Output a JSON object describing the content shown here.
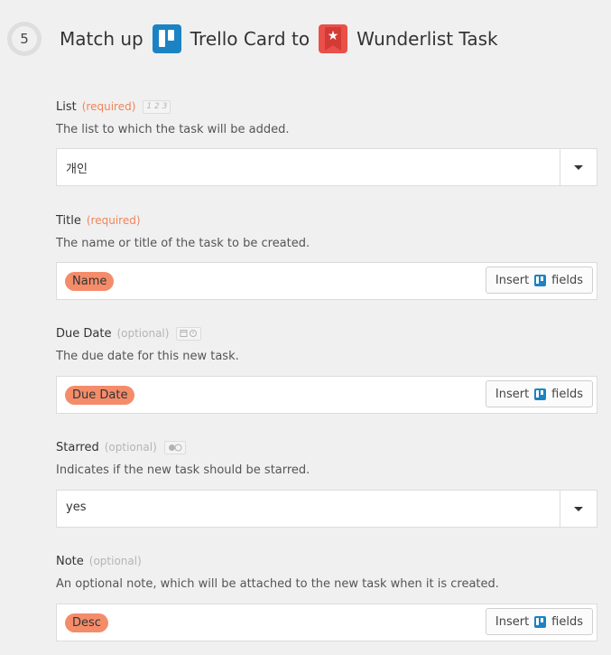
{
  "step": {
    "number": "5"
  },
  "header": {
    "prefix": "Match up",
    "source_app": "Trello Card to",
    "target_app": "Wunderlist Task",
    "source_icon": "trello-icon",
    "target_icon": "wunderlist-icon"
  },
  "fields": [
    {
      "label": "List",
      "qualifier": "(required)",
      "badge": "1 2 3",
      "description": "The list to which the task will be added.",
      "kind": "select",
      "value": "개인"
    },
    {
      "label": "Title",
      "qualifier": "(required)",
      "description": "The name or title of the task to be created.",
      "kind": "mapped",
      "token": "Name",
      "insert_label": "Insert",
      "fields_label": "fields"
    },
    {
      "label": "Due Date",
      "qualifier": "(optional)",
      "badge_icons": "calendar-clock-icon",
      "description": "The due date for this new task.",
      "kind": "mapped",
      "token": "Due Date",
      "insert_label": "Insert",
      "fields_label": "fields"
    },
    {
      "label": "Starred",
      "qualifier": "(optional)",
      "badge_icons": "toggle-icon",
      "description": "Indicates if the new task should be starred.",
      "kind": "select",
      "value": "yes"
    },
    {
      "label": "Note",
      "qualifier": "(optional)",
      "description": "An optional note, which will be attached to the new task when it is created.",
      "kind": "mapped",
      "token": "Desc",
      "insert_label": "Insert",
      "fields_label": "fields"
    }
  ],
  "colors": {
    "required": "#f0845c",
    "token_pill": "#f48c6a",
    "trello_blue": "#1b83c4",
    "wunderlist_red": "#e9504a"
  }
}
